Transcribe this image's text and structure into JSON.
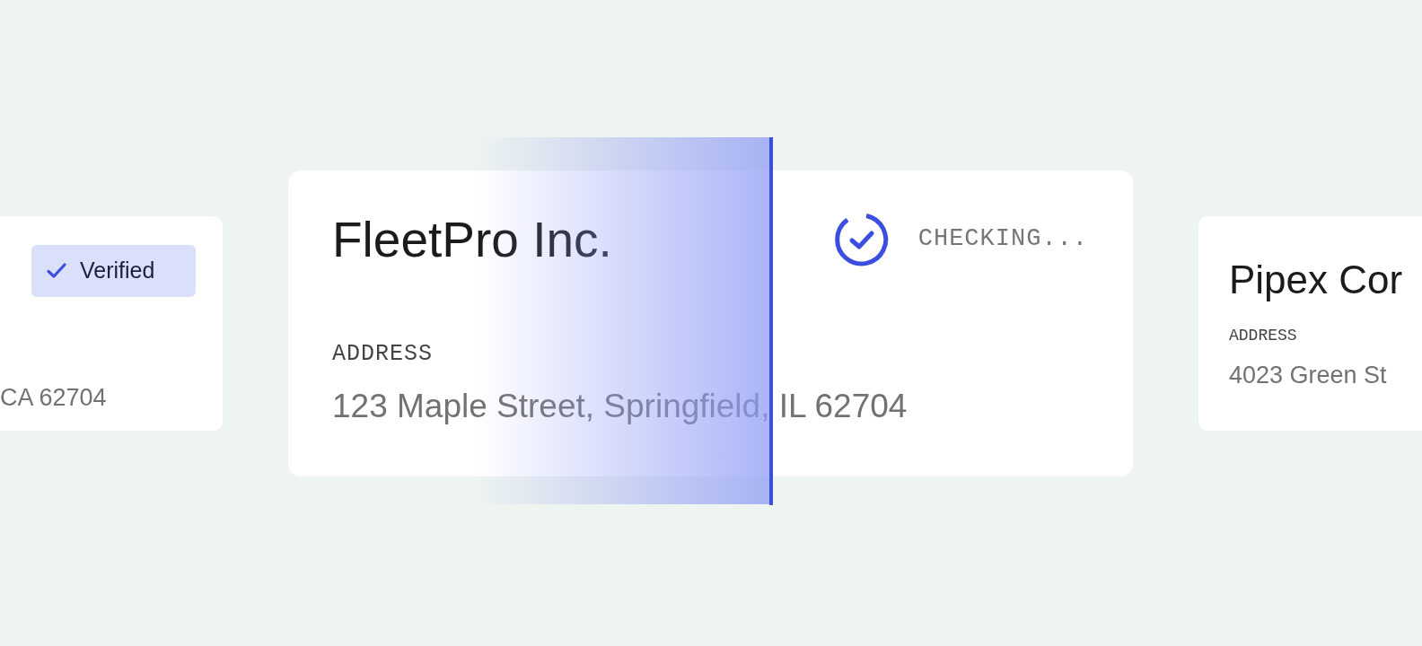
{
  "cards": [
    {
      "status": {
        "kind": "verified",
        "label": "Verified"
      },
      "address": "CA 62704"
    },
    {
      "name": "FleetPro Inc.",
      "status": {
        "kind": "checking",
        "label": "CHECKING..."
      },
      "address_label": "ADDRESS",
      "address": "123 Maple Street, Springfield, IL 62704"
    },
    {
      "name": "Pipex Cor",
      "address_label": "ADDRESS",
      "address": "4023 Green St"
    }
  ]
}
